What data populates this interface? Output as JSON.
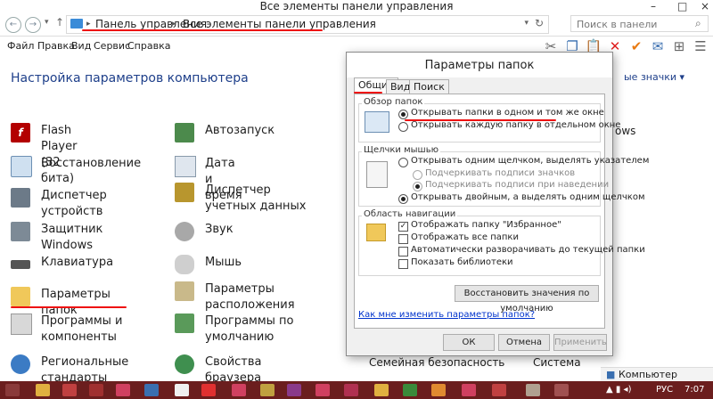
{
  "window": {
    "title": "Все элементы панели управления"
  },
  "address": {
    "crumbs": [
      "Панель управления",
      "Все элементы панели управления"
    ],
    "search_placeholder": "Поиск в панели управления"
  },
  "menu": [
    "Файл",
    "Правка",
    "Вид",
    "Сервис",
    "Справка"
  ],
  "main": {
    "heading": "Настройка параметров компьютера",
    "view_label": "ые значки",
    "items_col1": [
      "Flash Player (32 бита)",
      "Восстановление",
      "Диспетчер устройств",
      "Защитник Windows",
      "Клавиатура",
      "Параметры папок",
      "Программы и компоненты",
      "Региональные стандарты"
    ],
    "items_col2": [
      "Автозапуск",
      "Дата и время",
      "Диспетчер учетных данных",
      "Звук",
      "Мышь",
      "Параметры расположения",
      "Программы по умолчанию",
      "Свойства браузера"
    ],
    "col3_partial": [
      "ows",
      "Семейная безопасность"
    ],
    "col4_partial": [
      "Система"
    ]
  },
  "dialog": {
    "title": "Параметры папок",
    "tabs": [
      "Общие",
      "Вид",
      "Поиск"
    ],
    "browse_group": "Обзор папок",
    "browse_opt1": "Открывать папки в одном и том же окне",
    "browse_opt2": "Открывать каждую папку в отдельном окне",
    "click_group": "Щелчки мышью",
    "click_opt1": "Открывать одним щелчком, выделять указателем",
    "click_sub1": "Подчеркивать подписи значков",
    "click_sub2": "Подчеркивать подписи при наведении",
    "click_opt2": "Открывать двойным, а выделять одним щелчком",
    "nav_group": "Область навигации",
    "nav_opt1": "Отображать папку \"Избранное\"",
    "nav_opt2": "Отображать все папки",
    "nav_opt3": "Автоматически разворачивать до текущей папки",
    "nav_opt4": "Показать библиотеки",
    "restore_btn": "Восстановить значения по умолчанию",
    "help_link": "Как мне изменить параметры папок?",
    "ok": "ОК",
    "cancel": "Отмена",
    "apply": "Применить"
  },
  "statusbar": {
    "label": "Компьютер"
  },
  "tray": {
    "lang": "РУС",
    "time": "7:07"
  },
  "colors": {
    "accent_red": "#e11111",
    "link_blue": "#0033cc",
    "taskbar": "#6b1e1e"
  }
}
